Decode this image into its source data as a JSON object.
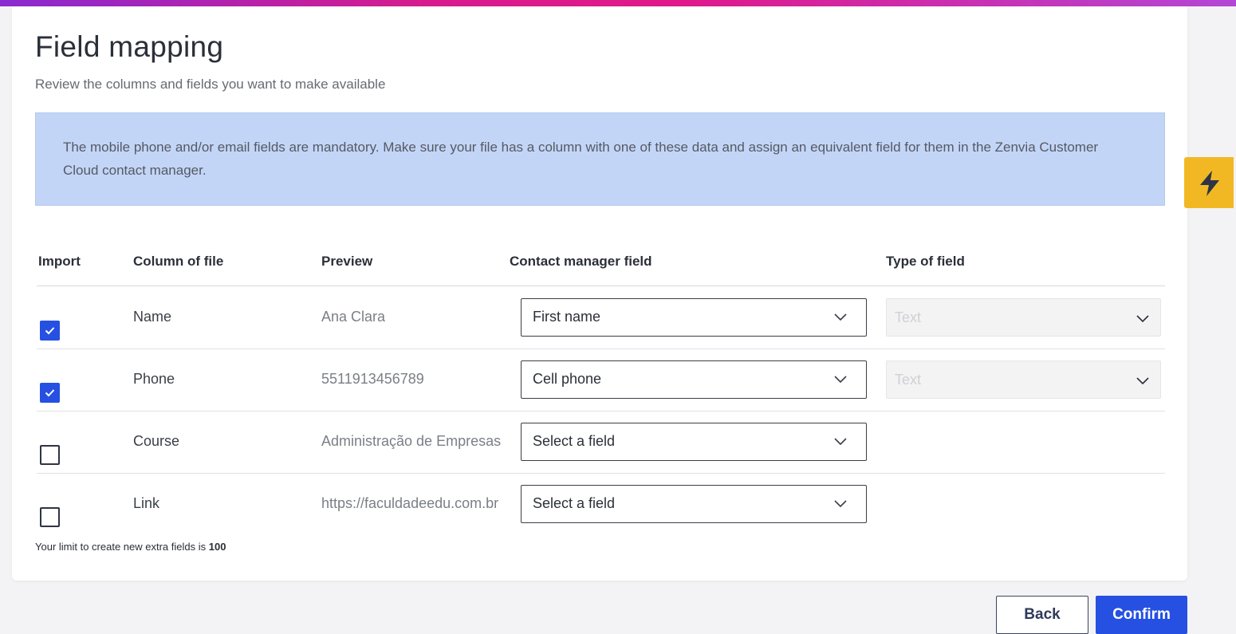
{
  "header": {
    "title": "Field mapping",
    "subtitle": "Review the columns and fields you want to make available"
  },
  "info_box": {
    "text": "The mobile phone and/or email fields are mandatory. Make sure your file has a column with one of these data and assign an equivalent field for them in the Zenvia Customer Cloud contact manager."
  },
  "table": {
    "headers": {
      "import": "Import",
      "column": "Column of file",
      "preview": "Preview",
      "field": "Contact manager field",
      "type": "Type of field"
    },
    "rows": [
      {
        "checked": true,
        "column": "Name",
        "preview": "Ana Clara",
        "field": "First name",
        "type": "Text"
      },
      {
        "checked": true,
        "column": "Phone",
        "preview": "5511913456789",
        "field": "Cell phone",
        "type": "Text"
      },
      {
        "checked": false,
        "column": "Course",
        "preview": "Administração de Empresas",
        "field": "Select a field",
        "type": null
      },
      {
        "checked": false,
        "column": "Link",
        "preview": "https://faculdadeedu.com.br",
        "field": "Select a field",
        "type": null
      }
    ]
  },
  "limit": {
    "text": "Your limit to create new extra fields is ",
    "value": "100"
  },
  "buttons": {
    "back": "Back",
    "confirm": "Confirm"
  },
  "icons": {
    "checkbox_checked": "check-icon",
    "dropdown": "chevron-down-icon",
    "floating": "lightning-bolt-icon"
  },
  "colors": {
    "primary": "#2650e2",
    "info_background": "#c3d5f7",
    "accent_bolt": "#f2b824"
  }
}
